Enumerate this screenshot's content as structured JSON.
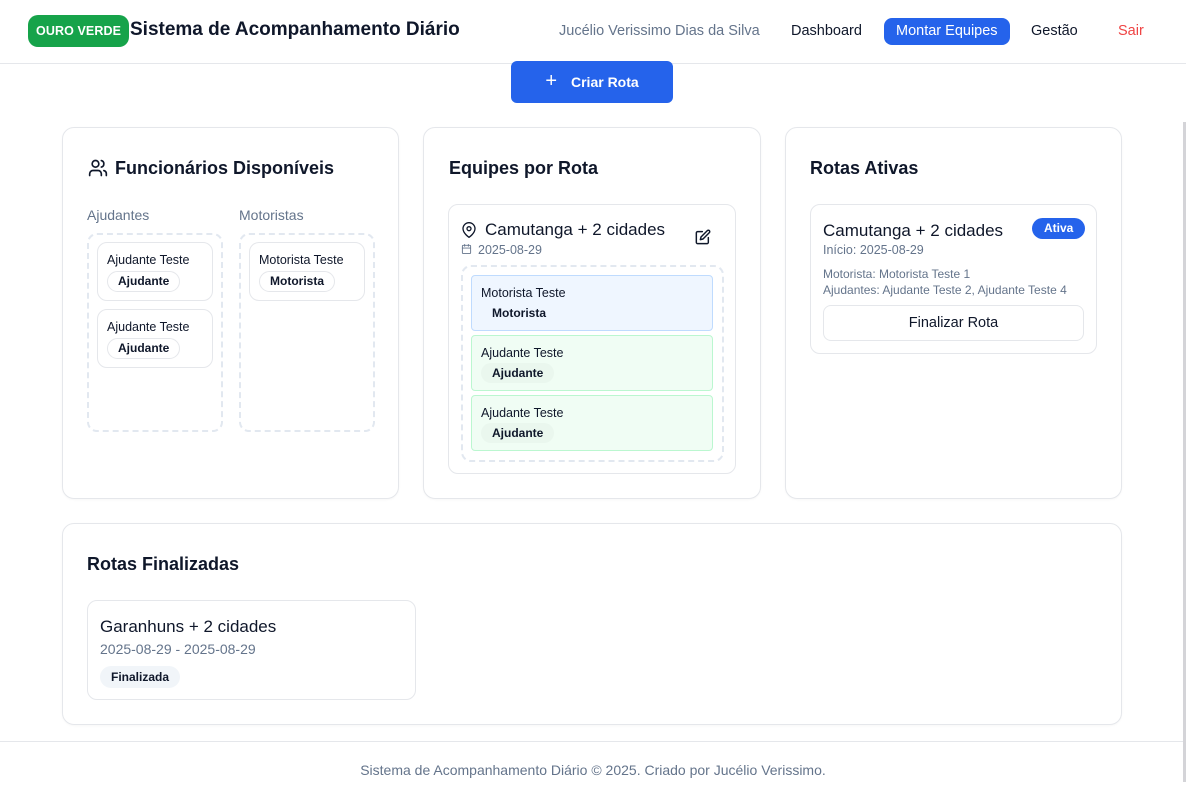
{
  "header": {
    "brand_badge": "OURO VERDE",
    "title": "Sistema de Acompanhamento Diário",
    "user_name": "Jucélio Verissimo Dias da Silva",
    "nav": {
      "dashboard": "Dashboard",
      "montar_equipes": "Montar Equipes",
      "gestao": "Gestão",
      "sair": "Sair"
    },
    "active_nav": "Montar Equipes"
  },
  "create_route_button": "Criar Rota",
  "available_employees": {
    "title": "Funcionários Disponíveis",
    "ajudantes_label": "Ajudantes",
    "motoristas_label": "Motoristas",
    "ajudantes": [
      {
        "name": "Ajudante Teste",
        "role": "Ajudante"
      },
      {
        "name": "Ajudante Teste",
        "role": "Ajudante"
      }
    ],
    "motoristas": [
      {
        "name": "Motorista Teste",
        "role": "Motorista"
      }
    ]
  },
  "teams_by_route": {
    "title": "Equipes por Rota",
    "route": {
      "name": "Camutanga + 2 cidades",
      "date": "2025-08-29",
      "members": [
        {
          "name": "Motorista Teste",
          "role": "Motorista"
        },
        {
          "name": "Ajudante Teste",
          "role": "Ajudante"
        },
        {
          "name": "Ajudante Teste",
          "role": "Ajudante"
        }
      ]
    }
  },
  "active_routes": {
    "title": "Rotas Ativas",
    "route": {
      "name": "Camutanga + 2 cidades",
      "status": "Ativa",
      "start": "Início: 2025-08-29",
      "driver": "Motorista: Motorista Teste 1",
      "helpers": "Ajudantes: Ajudante Teste 2, Ajudante Teste 4",
      "finish_button": "Finalizar Rota"
    }
  },
  "finished_routes": {
    "title": "Rotas Finalizadas",
    "route": {
      "name": "Garanhuns + 2 cidades",
      "dates": "2025-08-29 - 2025-08-29",
      "status": "Finalizada"
    }
  },
  "footer": "Sistema de Acompanhamento Diário © 2025. Criado por Jucélio Verissimo.",
  "colors": {
    "primary": "#2563eb",
    "brand_green": "#16a34a",
    "danger": "#ef4444",
    "muted": "#64748b",
    "motorista_bg": "#eff6ff",
    "ajudante_bg": "#f0fdf4"
  }
}
